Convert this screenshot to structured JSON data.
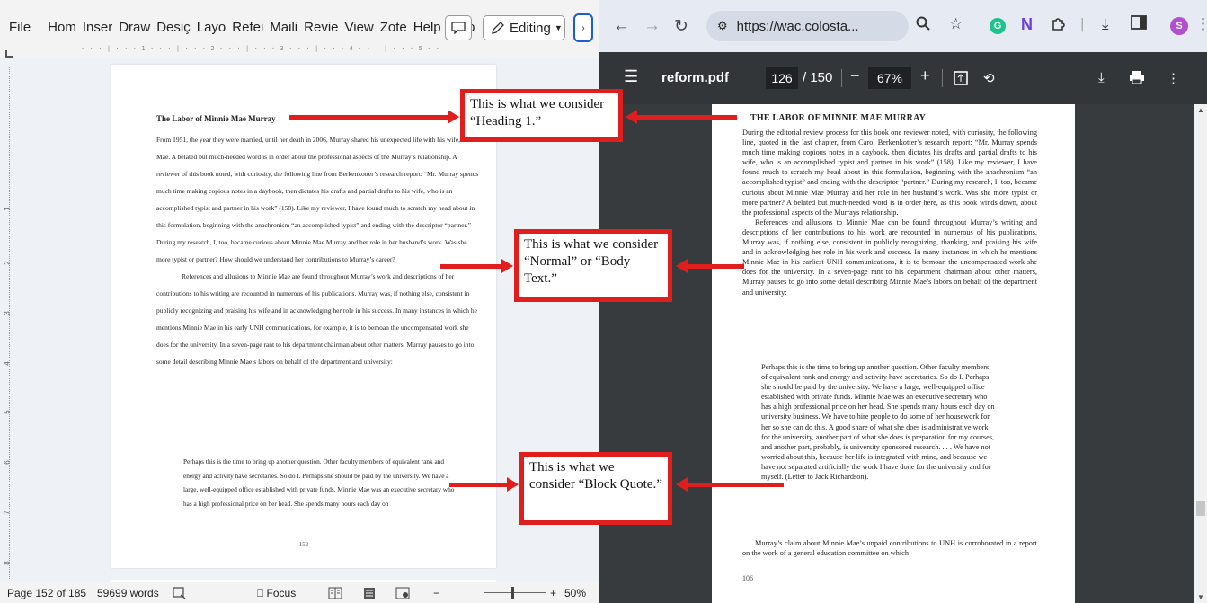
{
  "word": {
    "menu_tabs": [
      "File",
      "Hom",
      "Inser",
      "Draw",
      "Desiç",
      "Layo",
      "Refei",
      "Maili",
      "Revie",
      "View",
      "Zote",
      "Help",
      "Acro"
    ],
    "editing_label": "Editing",
    "ruler_text": "· · · | · · · 1 · · · | · · · 2 · · · | · · · 3 · · · | · · · 4 · · · | · · · 5 · · · | · · · 6 · · · | · · ·",
    "vruler_numbers": [
      "1",
      "2",
      "3",
      "4",
      "5",
      "6",
      "7",
      "8"
    ],
    "doc": {
      "heading": "The Labor of Minnie Mae Murray",
      "paragraph1": "From 1951, the year they were married, until her death in 2006, Murray shared his unexpected life with his wife, Minnie Mae. A belated but much-needed word is in order about the professional aspects of the Murray’s relationship. A reviewer of this book noted, with curiosity, the following line from Berkenkotter’s research report: “Mr. Murray spends much time making copious notes in a daybook, then dictates his drafts and partial drafts to his wife, who is an accomplished typist and partner in his work” (158). Like my reviewer, I have found much to scratch my head about in this formulation, beginning with the anachronism “an accomplished typist” and ending with the descriptor “partner.” During my research, I, too, became curious about Minnie Mae Murray and her role in her husband’s work. Was she more typist or partner? How should we understand her contributions to Murray’s career?",
      "paragraph2": "References and allusions to Minnie Mae are found throughout Murray’s work and descriptions of her contributions to his writing are recounted in numerous of his publications. Murray was, if nothing else, consistent in publicly recognizing and praising his wife and in acknowledging her role in his success. In many instances in which he mentions Minnie Mae in his early UNH communications, for example, it is to bemoan the uncompensated work she does for the university. In a seven-page rant to his department chairman about other matters, Murray pauses to go into some detail describing Minnie Mae’s labors on behalf of the department and university:",
      "quote": "Perhaps this is the time to bring up another question. Other faculty members of equivalent rank and energy and activity have secretaries. So do I. Perhaps she should be paid by the university. We have a large, well-equipped office established with private funds. Minnie Mae was an executive secretary who has a high professional price on her head. She spends many hours each day on",
      "page_number": "152"
    },
    "status": {
      "page": "Page 152 of 185",
      "words": "59699 words",
      "focus": "Focus",
      "zoom": "50%"
    }
  },
  "browser": {
    "url": "https://wac.colosta...",
    "profile_initial": "S",
    "pdf": {
      "filename": "reform.pdf",
      "current_page": "126",
      "total_pages": "/ 150",
      "zoom": "67%",
      "heading": "THE LABOR OF MINNIE MAE MURRAY",
      "paragraph1": "During the editorial review process for this book one reviewer noted, with curiosity, the following line, quoted in the last chapter, from Carol Berkenkotter’s research report: “Mr. Murray spends much time making copious notes in a daybook, then dictates his drafts and partial drafts to his wife, who is an accomplished typist and partner in his work” (158). Like my reviewer, I have found much to scratch my head about in this formulation, beginning with the anachronism “an accomplished typist” and ending with the descriptor “partner.” During my research, I, too, became curious about Minnie Mae Murray and her role in her husband’s work. Was she more typist or more partner? A belated but much-needed word is in order here, as this book winds down, about the professional aspects of the Murrays relationship.",
      "paragraph2": "References and allusions to Minnie Mae can be found throughout Murray’s writing and descriptions of her contributions to his work are recounted in numerous of his publications. Murray was, if nothing else, consistent in publicly recognizing, thanking, and praising his wife and in acknowledging her role in his work and success. In many instances in which he mentions Minnie Mae in his earliest UNH communications, it is to bemoan the uncompensated work she does for the university. In a seven-page rant to his department chairman about other matters, Murray pauses to go into some detail describing Minnie Mae’s labors on behalf of the department and university:",
      "quote": "Perhaps this is the time to bring up another question. Other faculty members of equivalent rank and energy and activity have secretaries. So do I. Perhaps she should be paid by the university. We have a large, well-equipped office established with private funds. Minnie Mae was an executive secretary who has a high professional price on her head. She spends many hours each day on university business. We have to hire people to do some of her housework for her so she can do this. A good share of what she does is administrative work for the university, another part of what she does is preparation for my courses, and another part, probably, is university sponsored research. . . . We have not worried about this, because her life is integrated with mine, and because we have not separated artificially the work I have done for the university and for myself. (Letter to Jack Richardson).",
      "after_quote": "Murray’s claim about Minnie Mae’s unpaid contributions to UNH is corroborated in a report on the work of a general education committee on which",
      "page_number": "106"
    }
  },
  "annotations": {
    "heading1": "This is what we consider “Heading 1.”",
    "normal": "This is what we consider “Normal” or “Body Text.”",
    "blockquote": "This is what we consider “Block Quote.”"
  },
  "colors": {
    "annotation_red": "#e11e1e",
    "word_accent": "#1a5fd0",
    "pdf_toolbar": "#323639",
    "pdf_backdrop": "#383b3e"
  }
}
